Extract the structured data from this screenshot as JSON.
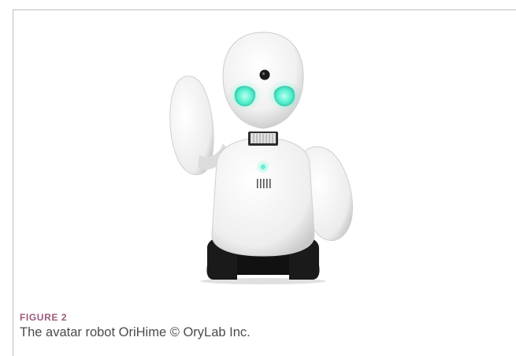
{
  "figure": {
    "label": "FIGURE 2",
    "caption": "The avatar robot OriHime © OryLab Inc.",
    "image_subject": "orihime-avatar-robot",
    "colors": {
      "label": "#9b5a7d",
      "caption": "#4b4b4b",
      "frame": "#bfbfbf",
      "eye_glow": "#57f0cf",
      "robot_body": "#f4f4f4",
      "base": "#1f1f1f"
    }
  }
}
